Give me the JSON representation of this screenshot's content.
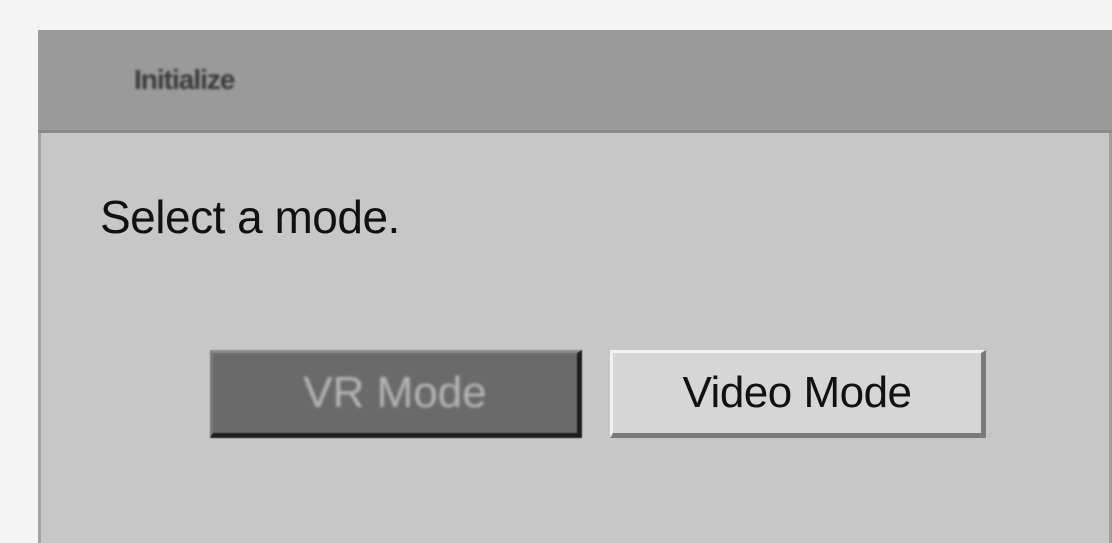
{
  "dialog": {
    "title": "Initialize",
    "prompt": "Select a mode."
  },
  "buttons": {
    "vr_mode": "VR Mode",
    "video_mode": "Video Mode"
  },
  "selected_button": "vr_mode"
}
